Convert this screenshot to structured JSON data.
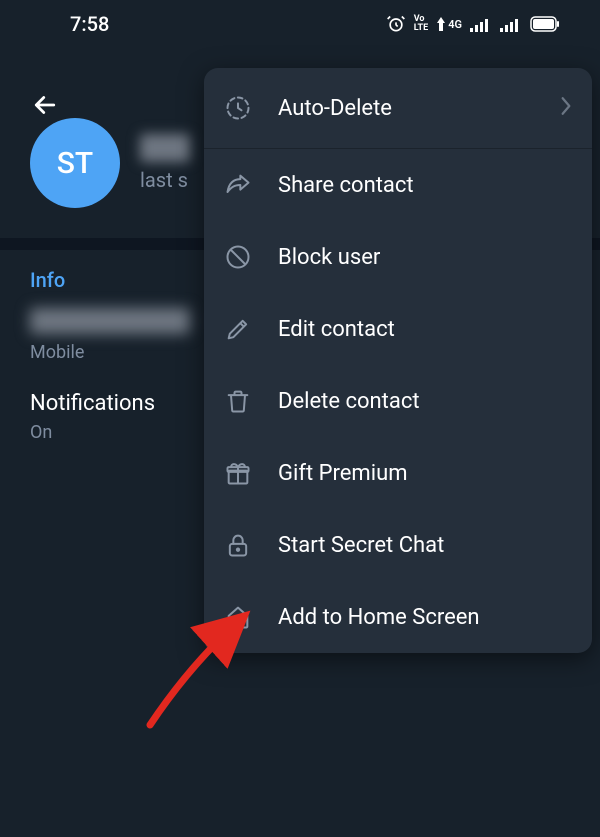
{
  "status_bar": {
    "time": "7:58",
    "volte": "Vo LTE",
    "network": "4G"
  },
  "profile": {
    "avatar_initials": "ST",
    "last_seen_prefix": "last s"
  },
  "info": {
    "section_label": "Info",
    "phone_type": "Mobile",
    "notifications_label": "Notifications",
    "notifications_value": "On"
  },
  "menu": {
    "auto_delete": "Auto-Delete",
    "share_contact": "Share contact",
    "block_user": "Block user",
    "edit_contact": "Edit contact",
    "delete_contact": "Delete contact",
    "gift_premium": "Gift Premium",
    "start_secret_chat": "Start Secret Chat",
    "add_to_home": "Add to Home Screen"
  }
}
